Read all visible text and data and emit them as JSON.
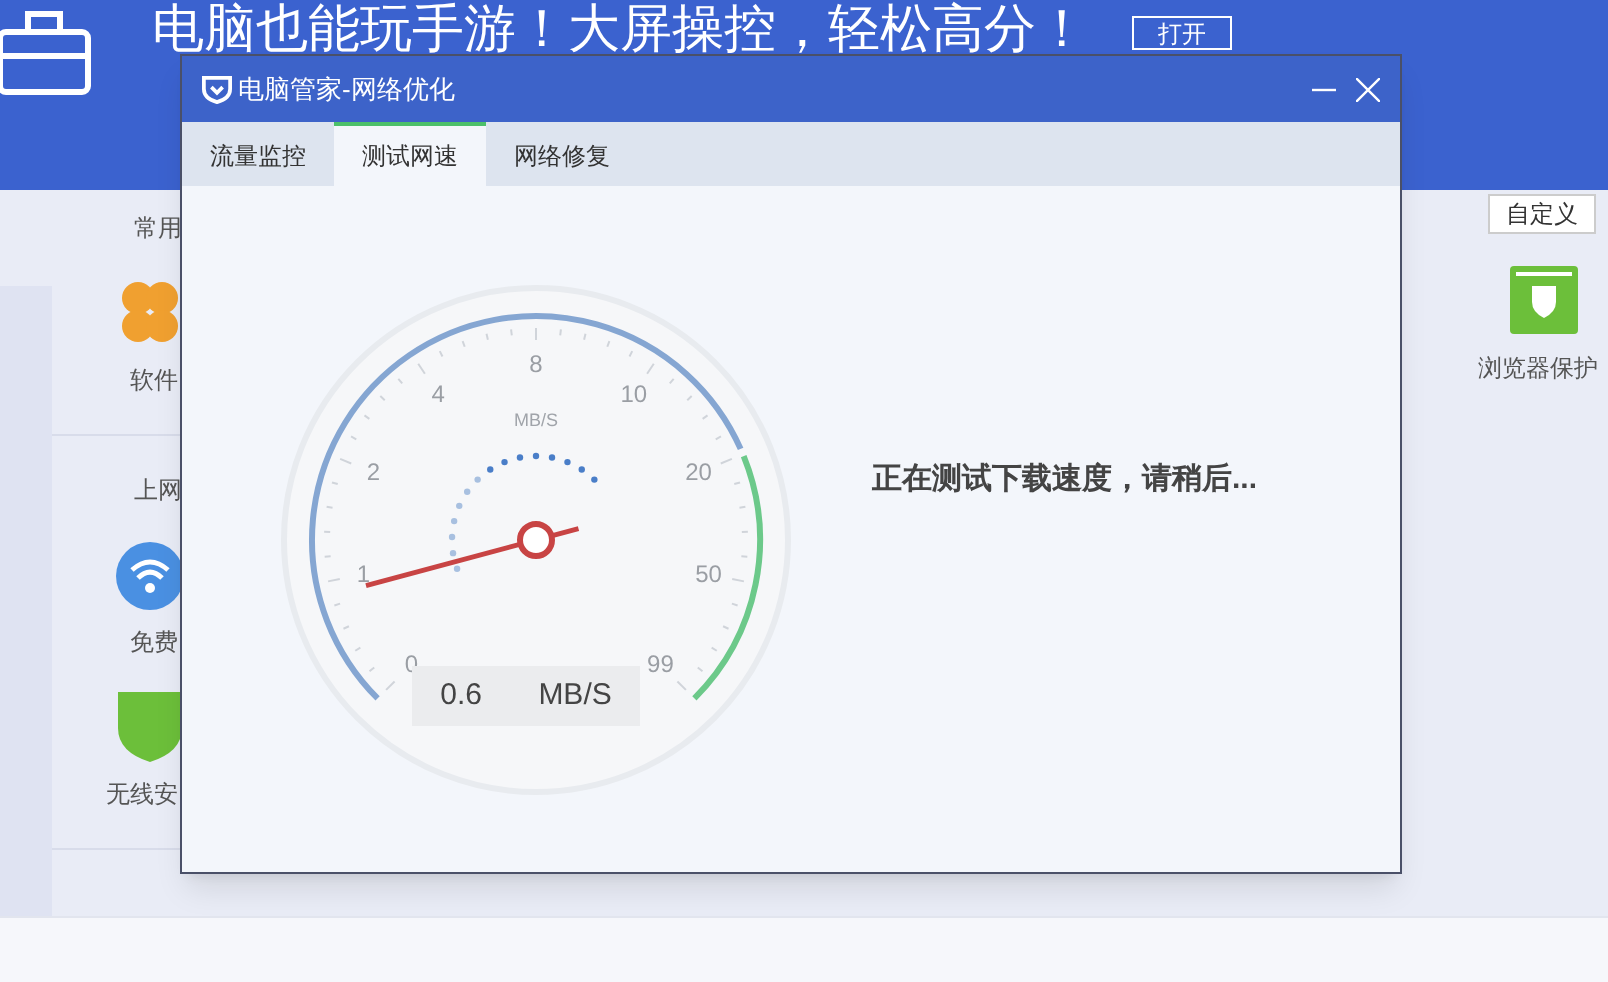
{
  "app": {
    "banner": {
      "headline": "电脑也能玩手游！大屏操控，轻松高分！",
      "open_button": "打开"
    },
    "sections": [
      {
        "title": "常用",
        "items": [
          {
            "label": "软件",
            "kind": "flower"
          }
        ]
      },
      {
        "title": "上网",
        "items": [
          {
            "label": "免费",
            "kind": "wifi"
          },
          {
            "label": "无线安",
            "kind": "shield"
          }
        ]
      }
    ],
    "customize_button": "自定义",
    "right_tool": "浏览器保护"
  },
  "dialog": {
    "title": "电脑管家-网络优化",
    "tabs": [
      {
        "label": "流量监控",
        "selected": false
      },
      {
        "label": "测试网速",
        "selected": true
      },
      {
        "label": "网络修复",
        "selected": false
      }
    ],
    "gauge": {
      "unit": "MB/S",
      "scale": [
        "0",
        "1",
        "2",
        "4",
        "8",
        "10",
        "20",
        "50",
        "99"
      ],
      "reading": "0.6",
      "reading_unit": "MB/S"
    },
    "status": "正在测试下载速度，请稍后..."
  }
}
